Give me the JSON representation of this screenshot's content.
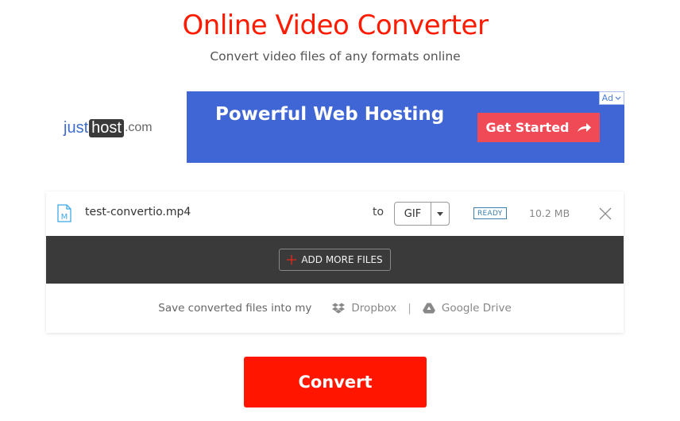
{
  "header": {
    "title": "Online Video Converter",
    "subtitle": "Convert video files of any formats online"
  },
  "ad": {
    "logo_part1": "just",
    "logo_part2": "host",
    "logo_part3": ".com",
    "headline": "Powerful Web Hosting",
    "cta_label": "Get Started",
    "badge_label": "Ad",
    "colors": {
      "background": "#4066d5",
      "cta": "#f04a56"
    }
  },
  "files": [
    {
      "name": "test-convertio.mp4",
      "to_label": "to",
      "format": "GIF",
      "status": "READY",
      "size": "10.2 MB"
    }
  ],
  "add_more": {
    "label": "ADD MORE FILES"
  },
  "save": {
    "text": "Save converted files into my",
    "dropbox": "Dropbox",
    "separator": "|",
    "google_drive": "Google Drive"
  },
  "convert": {
    "label": "Convert",
    "color": "#ff1500"
  },
  "colors": {
    "accent": "#ff1a00",
    "status": "#3c7fae"
  }
}
